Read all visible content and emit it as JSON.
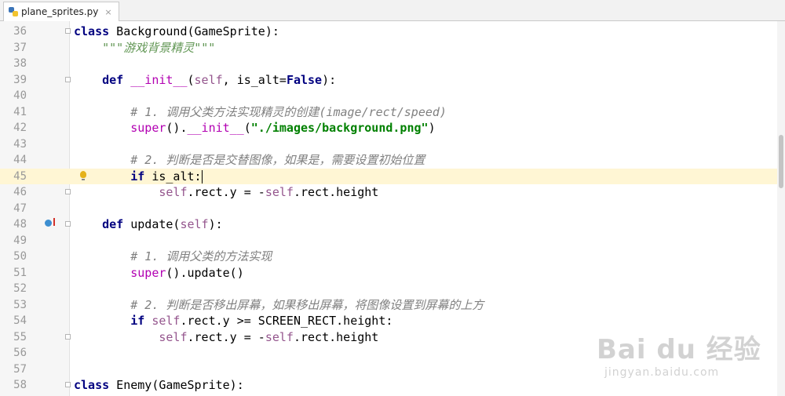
{
  "tab": {
    "filename": "plane_sprites.py",
    "close": "×",
    "icon": "python-file-icon"
  },
  "watermark": {
    "logo": "Bai du 经验",
    "url": "jingyan.baidu.com"
  },
  "lines": [
    {
      "num": "36",
      "tokens": [
        [
          "kw",
          "class"
        ],
        [
          "plain",
          " Background(GameSprite):"
        ]
      ],
      "fold": true
    },
    {
      "num": "37",
      "tokens": [
        [
          "plain",
          "    "
        ],
        [
          "doc",
          "\"\"\"游戏背景精灵\"\"\""
        ]
      ]
    },
    {
      "num": "38",
      "tokens": []
    },
    {
      "num": "39",
      "tokens": [
        [
          "plain",
          "    "
        ],
        [
          "kw",
          "def"
        ],
        [
          "plain",
          " "
        ],
        [
          "dund",
          "__init__"
        ],
        [
          "plain",
          "("
        ],
        [
          "slf",
          "self"
        ],
        [
          "plain",
          ", is_alt="
        ],
        [
          "kw",
          "False"
        ],
        [
          "plain",
          "):"
        ]
      ],
      "fold": true
    },
    {
      "num": "40",
      "tokens": []
    },
    {
      "num": "41",
      "tokens": [
        [
          "plain",
          "        "
        ],
        [
          "cmt",
          "# 1. 调用父类方法实现精灵的创建(image/rect/speed)"
        ]
      ]
    },
    {
      "num": "42",
      "tokens": [
        [
          "plain",
          "        "
        ],
        [
          "dund",
          "super"
        ],
        [
          "plain",
          "()."
        ],
        [
          "dund",
          "__init__"
        ],
        [
          "plain",
          "("
        ],
        [
          "str",
          "\"./images/background.png\""
        ],
        [
          "plain",
          ")"
        ]
      ]
    },
    {
      "num": "43",
      "tokens": []
    },
    {
      "num": "44",
      "tokens": [
        [
          "plain",
          "        "
        ],
        [
          "cmt",
          "# 2. 判断是否是交替图像，如果是，需要设置初始位置"
        ]
      ]
    },
    {
      "num": "45",
      "tokens": [
        [
          "plain",
          "        "
        ],
        [
          "kw",
          "if"
        ],
        [
          "plain",
          " is_alt:"
        ]
      ],
      "current": true,
      "bulb": true,
      "caret": true
    },
    {
      "num": "46",
      "tokens": [
        [
          "plain",
          "            "
        ],
        [
          "slf",
          "self"
        ],
        [
          "plain",
          ".rect.y = -"
        ],
        [
          "slf",
          "self"
        ],
        [
          "plain",
          ".rect.height"
        ]
      ],
      "fold": true
    },
    {
      "num": "47",
      "tokens": []
    },
    {
      "num": "48",
      "tokens": [
        [
          "plain",
          "    "
        ],
        [
          "kw",
          "def"
        ],
        [
          "plain",
          " update("
        ],
        [
          "slf",
          "self"
        ],
        [
          "plain",
          "):"
        ]
      ],
      "fold": true,
      "override": true
    },
    {
      "num": "49",
      "tokens": []
    },
    {
      "num": "50",
      "tokens": [
        [
          "plain",
          "        "
        ],
        [
          "cmt",
          "# 1. 调用父类的方法实现"
        ]
      ]
    },
    {
      "num": "51",
      "tokens": [
        [
          "plain",
          "        "
        ],
        [
          "dund",
          "super"
        ],
        [
          "plain",
          "().update()"
        ]
      ]
    },
    {
      "num": "52",
      "tokens": []
    },
    {
      "num": "53",
      "tokens": [
        [
          "plain",
          "        "
        ],
        [
          "cmt",
          "# 2. 判断是否移出屏幕，如果移出屏幕，将图像设置到屏幕的上方"
        ]
      ]
    },
    {
      "num": "54",
      "tokens": [
        [
          "plain",
          "        "
        ],
        [
          "kw",
          "if"
        ],
        [
          "plain",
          " "
        ],
        [
          "slf",
          "self"
        ],
        [
          "plain",
          ".rect.y >= SCREEN_RECT.height:"
        ]
      ]
    },
    {
      "num": "55",
      "tokens": [
        [
          "plain",
          "            "
        ],
        [
          "slf",
          "self"
        ],
        [
          "plain",
          ".rect.y = -"
        ],
        [
          "slf",
          "self"
        ],
        [
          "plain",
          ".rect.height"
        ]
      ],
      "fold": true
    },
    {
      "num": "56",
      "tokens": []
    },
    {
      "num": "57",
      "tokens": []
    },
    {
      "num": "58",
      "tokens": [
        [
          "kw",
          "class"
        ],
        [
          "plain",
          " Enemy(GameSprite):"
        ]
      ],
      "fold": true
    }
  ]
}
